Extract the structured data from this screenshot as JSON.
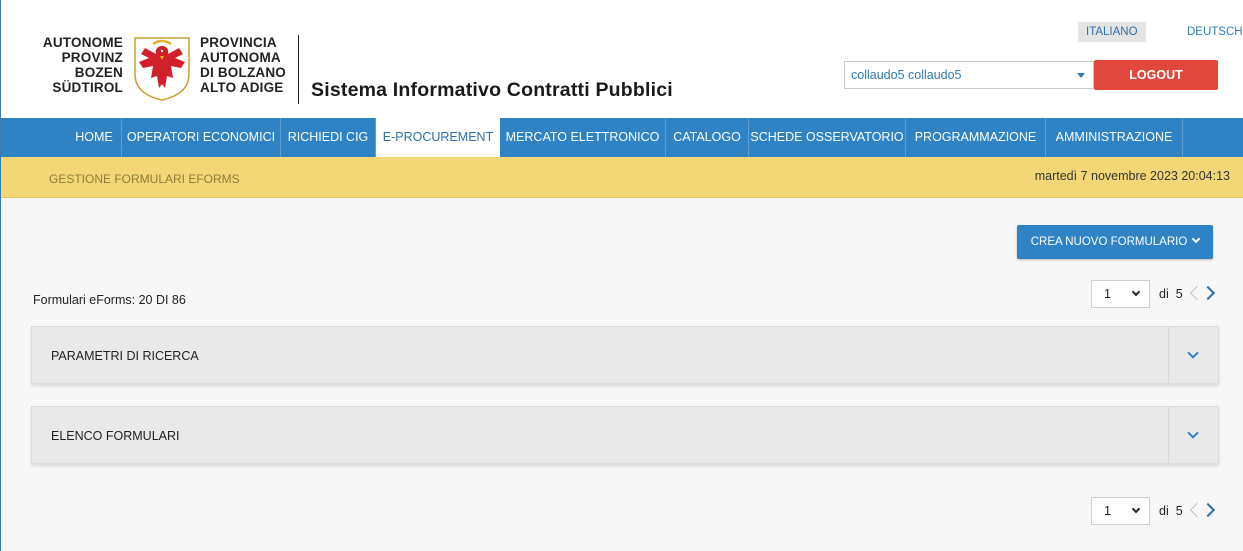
{
  "header": {
    "logo_left": [
      "AUTONOME",
      "PROVINZ",
      "BOZEN",
      "SÜDTIROL"
    ],
    "logo_right": [
      "PROVINCIA",
      "AUTONOMA",
      "DI BOLZANO",
      "ALTO ADIGE"
    ],
    "app_title": "Sistema Informativo Contratti Pubblici",
    "languages": [
      "ITALIANO",
      "DEUTSCH"
    ],
    "active_language": "ITALIANO",
    "user_selected": "collaudo5 collaudo5",
    "logout_label": "LOGOUT"
  },
  "nav": {
    "items": [
      "HOME",
      "OPERATORI ECONOMICI",
      "RICHIEDI CIG",
      "E-PROCUREMENT",
      "MERCATO ELETTRONICO",
      "CATALOGO",
      "SCHEDE OSSERVATORIO",
      "PROGRAMMAZIONE",
      "AMMINISTRAZIONE"
    ],
    "active": "E-PROCUREMENT"
  },
  "subbar": {
    "breadcrumb": "GESTIONE FORMULARI EFORMS",
    "datetime": "martedì 7 novembre 2023 20:04:13"
  },
  "main": {
    "new_button_label": "CREA NUOVO FORMULARIO",
    "count_label": "Formulari eForms: 20 DI 86",
    "pager": {
      "current_page": "1",
      "of_label": "di",
      "total_pages": "5"
    },
    "panels": [
      "PARAMETRI DI RICERCA",
      "ELENCO FORMULARI"
    ]
  },
  "colors": {
    "nav_bg": "#2f82c4",
    "subbar_bg": "#f3d777",
    "logout_bg": "#e2473d",
    "link": "#2f7cb8"
  }
}
